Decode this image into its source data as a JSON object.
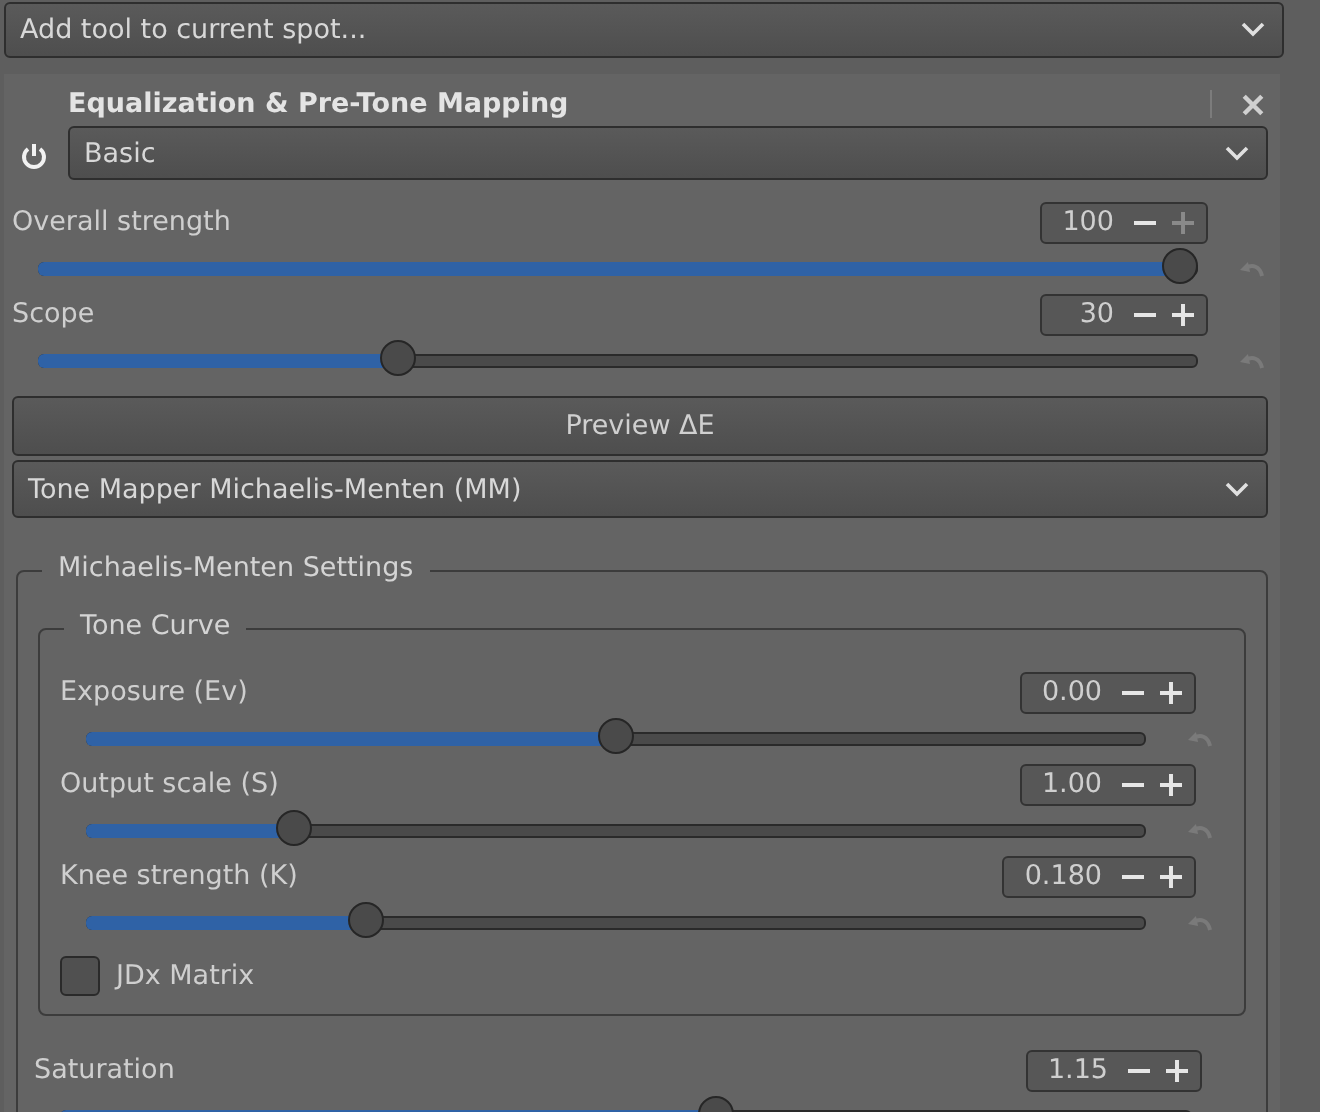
{
  "add_tool": {
    "placeholder": "Add tool to current spot..."
  },
  "panel": {
    "title": "Equalization & Pre-Tone Mapping",
    "enabled": true,
    "mode": "Basic",
    "sliders": [
      {
        "label": "Overall strength",
        "value": "100",
        "level": 0.985,
        "plus_disabled": true
      },
      {
        "label": "Scope",
        "value": "30",
        "level": 0.31,
        "plus_disabled": false
      }
    ],
    "preview_button": "Preview ΔE",
    "tone_mapper": "Tone Mapper Michaelis-Menten (MM)",
    "settings": {
      "title": "Michaelis-Menten Settings",
      "tone_curve": {
        "title": "Tone Curve",
        "sliders": [
          {
            "label": "Exposure (Ev)",
            "value": "0.00",
            "level": 0.5,
            "plus_disabled": false
          },
          {
            "label": "Output scale (S)",
            "value": "1.00",
            "level": 0.197,
            "plus_disabled": false
          },
          {
            "label": "Knee strength (K)",
            "value": "0.180",
            "level": 0.264,
            "plus_disabled": false
          }
        ],
        "checkbox": {
          "label": "JDx Matrix",
          "checked": false
        }
      },
      "sliders": [
        {
          "label": "Saturation",
          "value": "1.15",
          "level": 0.58,
          "plus_disabled": false
        }
      ]
    }
  }
}
